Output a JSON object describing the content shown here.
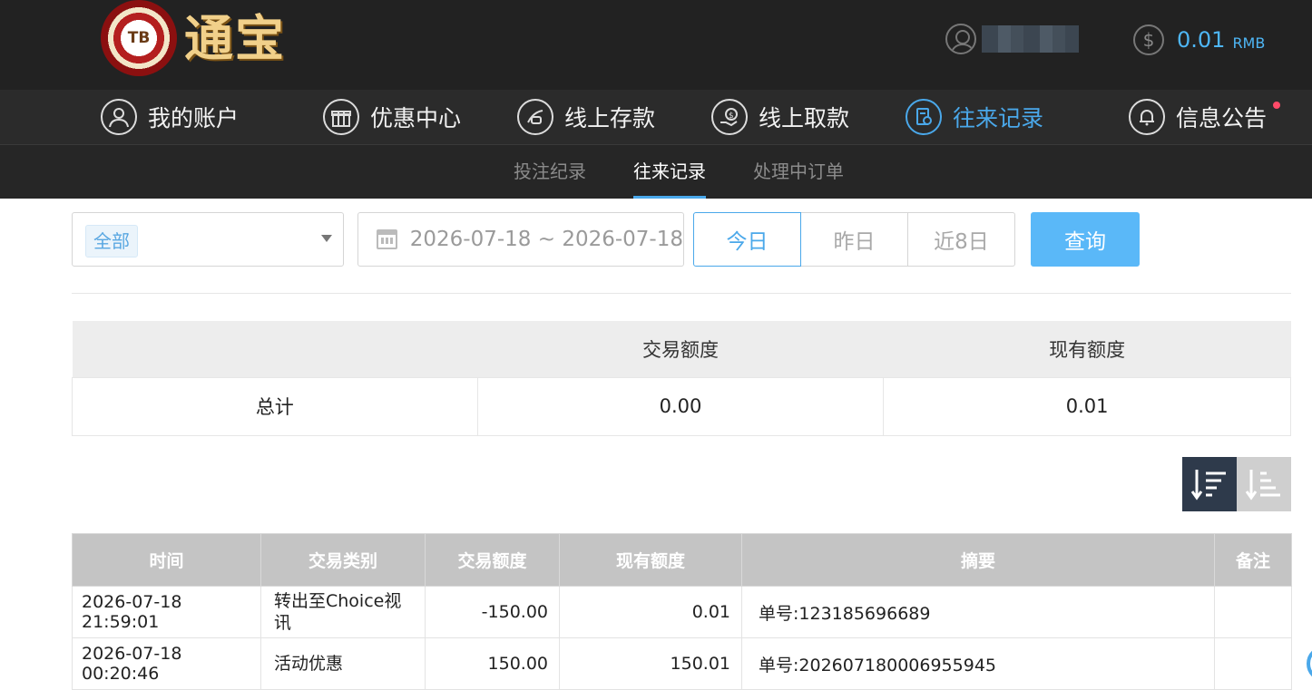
{
  "brand": {
    "chip_text": "TB",
    "name": "通宝"
  },
  "header": {
    "balance_value": "0.01",
    "balance_unit": "RMB"
  },
  "nav": [
    {
      "label": "我的账户",
      "icon": "user-icon"
    },
    {
      "label": "优惠中心",
      "icon": "gift-icon"
    },
    {
      "label": "线上存款",
      "icon": "deposit-icon"
    },
    {
      "label": "线上取款",
      "icon": "withdraw-icon"
    },
    {
      "label": "往来记录",
      "icon": "records-icon",
      "active": true
    },
    {
      "label": "信息公告",
      "icon": "bell-icon"
    }
  ],
  "subnav": [
    {
      "label": "投注纪录"
    },
    {
      "label": "往来记录",
      "active": true
    },
    {
      "label": "处理中订单"
    }
  ],
  "filter": {
    "type_selected": "全部",
    "date_range": "2026-07-18 ~ 2026-07-18",
    "quick": [
      "今日",
      "昨日",
      "近8日"
    ],
    "quick_active": "今日",
    "query_label": "查询"
  },
  "summary": {
    "headers": [
      "",
      "交易额度",
      "现有额度"
    ],
    "row_label": "总计",
    "trade_amount": "0.00",
    "current_amount": "0.01"
  },
  "records": {
    "headers": [
      "时间",
      "交易类别",
      "交易额度",
      "现有额度",
      "摘要",
      "备注"
    ],
    "rows": [
      [
        "2026-07-18 21:59:01",
        "转出至Choice视讯",
        "-150.00",
        "0.01",
        "单号:123185696689",
        ""
      ],
      [
        "2026-07-18 00:20:46",
        "活动优惠",
        "150.00",
        "150.01",
        "单号:202607180006955945",
        ""
      ]
    ]
  },
  "colors": {
    "accent": "#4aa8ea",
    "topbar": "#222222",
    "query_button": "#5ab8f8",
    "notice_dot": "#ff4a68"
  }
}
